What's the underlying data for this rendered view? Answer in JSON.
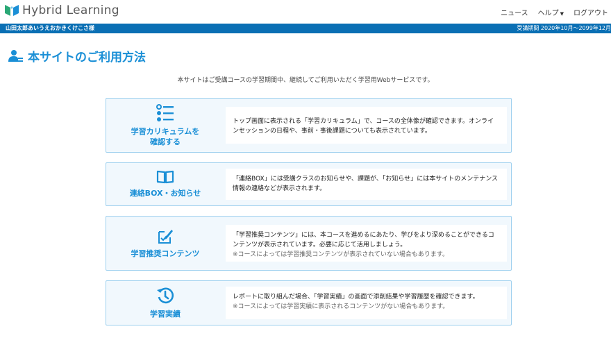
{
  "header": {
    "logo_text": "Hybrid Learning",
    "nav": {
      "news": "ニュース",
      "help": "ヘルプ",
      "logout": "ログアウト"
    }
  },
  "userbar": {
    "user_name": "山田太郎あいうえおかきくけこさ様",
    "period": "受講期間 2020年10月〜2099年12月"
  },
  "page": {
    "title": "本サイトのご利用方法",
    "intro": "本サイトはご受講コースの学習期間中、継続してご利用いただく学習用Webサービスです。"
  },
  "cards": [
    {
      "icon": "list-icon",
      "label_line1": "学習カリキュラムを",
      "label_line2": "確認する",
      "text": "トップ画面に表示される「学習カリキュラム」で、コースの全体像が確認できます。オンラインセッションの日程や、事前・事後課題についても表示されています。",
      "note": ""
    },
    {
      "icon": "book-icon",
      "label_line1": "連絡BOX・お知らせ",
      "label_line2": "",
      "text": "「連絡BOX」には受講クラスのお知らせや、課題が、「お知らせ」には本サイトのメンテナンス情報の連絡などが表示されます。",
      "note": ""
    },
    {
      "icon": "edit-check-icon",
      "label_line1": "学習推奨コンテンツ",
      "label_line2": "",
      "text": "「学習推奨コンテンツ」には、本コースを進めるにあたり、学びをより深めることができるコンテンツが表示されています。必要に応じて活用しましょう。",
      "note": "※コースによっては学習推奨コンテンツが表示されていない場合もあります。"
    },
    {
      "icon": "history-icon",
      "label_line1": "学習実績",
      "label_line2": "",
      "text": "レポートに取り組んだ場合、「学習実績」の画面で添削結果や学習履歴を確認できます。",
      "note": "※コースによっては学習実績に表示されるコンテンツがない場合もあります。"
    }
  ],
  "colors": {
    "accent": "#1a8fd6",
    "bar": "#0a6fb4",
    "logo_green": "#2aa876",
    "card_bg": "#f1f8fd",
    "card_border": "#9ccfee"
  }
}
